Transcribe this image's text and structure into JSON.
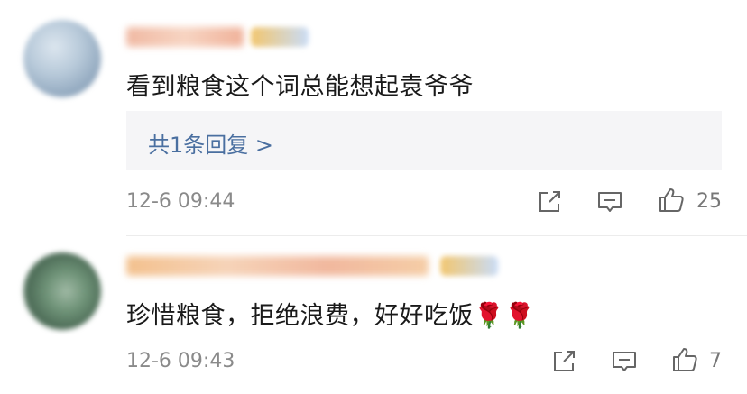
{
  "comments": [
    {
      "text": "看到粮食这个词总能想起袁爷爷",
      "reply_summary": "共1条回复 >",
      "timestamp": "12-6 09:44",
      "likes": "25",
      "icons": [
        "share-icon",
        "reply-icon",
        "like-icon"
      ]
    },
    {
      "text": "珍惜粮食，拒绝浪费，好好吃饭🌹🌹",
      "timestamp": "12-6 09:43",
      "likes": "7",
      "icons": [
        "share-icon",
        "reply-icon",
        "like-icon"
      ]
    }
  ],
  "colors": {
    "link": "#4a6fa0",
    "timestamp": "#8a8a8a",
    "reply_box_bg": "#f5f5f7"
  }
}
